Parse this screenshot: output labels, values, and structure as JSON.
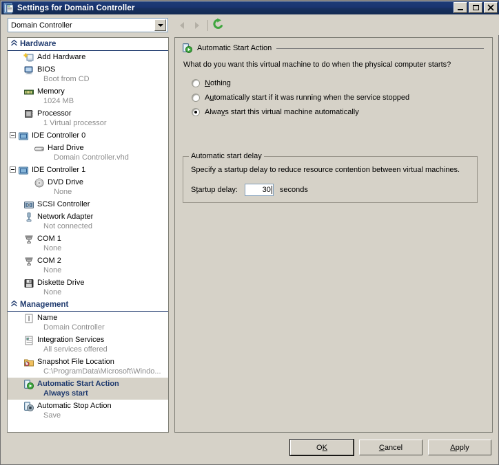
{
  "window": {
    "title": "Settings for Domain Controller",
    "title_icon": "settings-document-icon",
    "minimize_label": "Minimize",
    "maximize_label": "Maximize",
    "close_label": "Close"
  },
  "toolbar": {
    "vm_selector_value": "Domain Controller",
    "back_label": "Back",
    "forward_label": "Forward",
    "refresh_label": "Refresh",
    "dropdown_icon": "chevron-down-icon",
    "back_icon": "arrow-left-icon",
    "forward_icon": "arrow-right-icon",
    "refresh_icon": "refresh-icon"
  },
  "tree": {
    "sections": [
      {
        "title": "Hardware",
        "chevron_icon": "collapse-chevron-icon",
        "items": [
          {
            "label": "Add Hardware",
            "sub": "",
            "icon": "add-hardware-icon",
            "indent": 1,
            "expander": "",
            "selected": false
          },
          {
            "label": "BIOS",
            "sub": "Boot from CD",
            "icon": "bios-icon",
            "indent": 1,
            "expander": "",
            "selected": false
          },
          {
            "label": "Memory",
            "sub": "1024 MB",
            "icon": "memory-icon",
            "indent": 1,
            "expander": "",
            "selected": false
          },
          {
            "label": "Processor",
            "sub": "1 Virtual processor",
            "icon": "processor-icon",
            "indent": 1,
            "expander": "",
            "selected": false
          },
          {
            "label": "IDE Controller 0",
            "sub": "",
            "icon": "ide-controller-icon",
            "indent": 0,
            "expander": "minus",
            "selected": false
          },
          {
            "label": "Hard Drive",
            "sub": "Domain Controller.vhd",
            "icon": "hard-drive-icon",
            "indent": 2,
            "expander": "",
            "selected": false
          },
          {
            "label": "IDE Controller 1",
            "sub": "",
            "icon": "ide-controller-icon",
            "indent": 0,
            "expander": "minus",
            "selected": false
          },
          {
            "label": "DVD Drive",
            "sub": "None",
            "icon": "dvd-drive-icon",
            "indent": 2,
            "expander": "",
            "selected": false
          },
          {
            "label": "SCSI Controller",
            "sub": "",
            "icon": "scsi-controller-icon",
            "indent": 1,
            "expander": "",
            "selected": false
          },
          {
            "label": "Network Adapter",
            "sub": "Not connected",
            "icon": "network-adapter-icon",
            "indent": 1,
            "expander": "",
            "selected": false
          },
          {
            "label": "COM 1",
            "sub": "None",
            "icon": "com-port-icon",
            "indent": 1,
            "expander": "",
            "selected": false
          },
          {
            "label": "COM 2",
            "sub": "None",
            "icon": "com-port-icon",
            "indent": 1,
            "expander": "",
            "selected": false
          },
          {
            "label": "Diskette Drive",
            "sub": "None",
            "icon": "diskette-drive-icon",
            "indent": 1,
            "expander": "",
            "selected": false
          }
        ]
      },
      {
        "title": "Management",
        "chevron_icon": "collapse-chevron-icon",
        "items": [
          {
            "label": "Name",
            "sub": "Domain Controller",
            "icon": "name-icon",
            "indent": 1,
            "expander": "",
            "selected": false
          },
          {
            "label": "Integration Services",
            "sub": "All services offered",
            "icon": "integration-services-icon",
            "indent": 1,
            "expander": "",
            "selected": false
          },
          {
            "label": "Snapshot File Location",
            "sub": "C:\\ProgramData\\Microsoft\\Windo...",
            "icon": "snapshot-folder-icon",
            "indent": 1,
            "expander": "",
            "selected": false
          },
          {
            "label": "Automatic Start Action",
            "sub": "Always start",
            "icon": "automatic-start-action-icon",
            "indent": 1,
            "expander": "",
            "selected": true
          },
          {
            "label": "Automatic Stop Action",
            "sub": "Save",
            "icon": "automatic-stop-action-icon",
            "indent": 1,
            "expander": "",
            "selected": false
          }
        ]
      }
    ]
  },
  "content": {
    "header": "Automatic Start Action",
    "header_icon": "automatic-start-action-icon",
    "prompt": "What do you want this virtual machine to do when the physical computer starts?",
    "radios": [
      {
        "label_before": "",
        "accel": "N",
        "label_after": "othing",
        "checked": false
      },
      {
        "label_before": "A",
        "accel": "u",
        "label_after": "tomatically start if it was running when the service stopped",
        "checked": false
      },
      {
        "label_before": "Alwa",
        "accel": "y",
        "label_after": "s start this virtual machine automatically",
        "checked": true
      }
    ],
    "group": {
      "title": "Automatic start delay",
      "description": "Specify a startup delay to reduce resource contention between virtual machines.",
      "delay_label_before": "S",
      "delay_label_accel": "t",
      "delay_label_after": "artup delay:",
      "delay_value": "30",
      "delay_unit": "seconds"
    }
  },
  "buttons": {
    "ok_before": "O",
    "ok_accel": "K",
    "ok_after": "",
    "cancel_before": "",
    "cancel_accel": "C",
    "cancel_after": "ancel",
    "apply_before": "",
    "apply_accel": "A",
    "apply_after": "pply"
  },
  "colors": {
    "title_bar": "#1a3470",
    "dialog_face": "#d6d2c8",
    "section_header_text": "#1f3a6e",
    "selected_text": "#1f3a6e",
    "sub_text": "#8c8c8c",
    "accent_green": "#3fa63f"
  }
}
